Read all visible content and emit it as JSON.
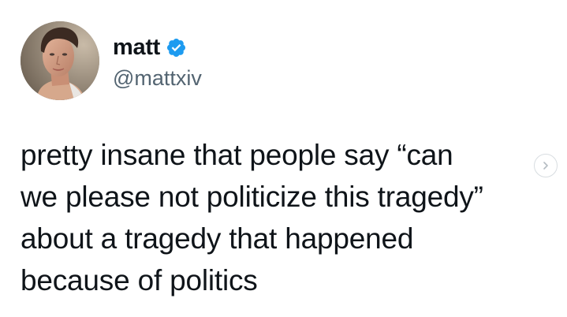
{
  "author": {
    "display_name": "matt",
    "handle": "@mattxiv",
    "verified": true,
    "avatar_icon": "profile-photo"
  },
  "tweet": {
    "text": "pretty insane that people say “can\nwe please not politicize this tragedy”\nabout a tragedy that happened\nbecause of politics"
  },
  "controls": {
    "next_icon": "chevron-right-icon"
  },
  "colors": {
    "text": "#0f1419",
    "secondary_text": "#536471",
    "verified_blue": "#1d9bf0",
    "background": "#ffffff"
  }
}
